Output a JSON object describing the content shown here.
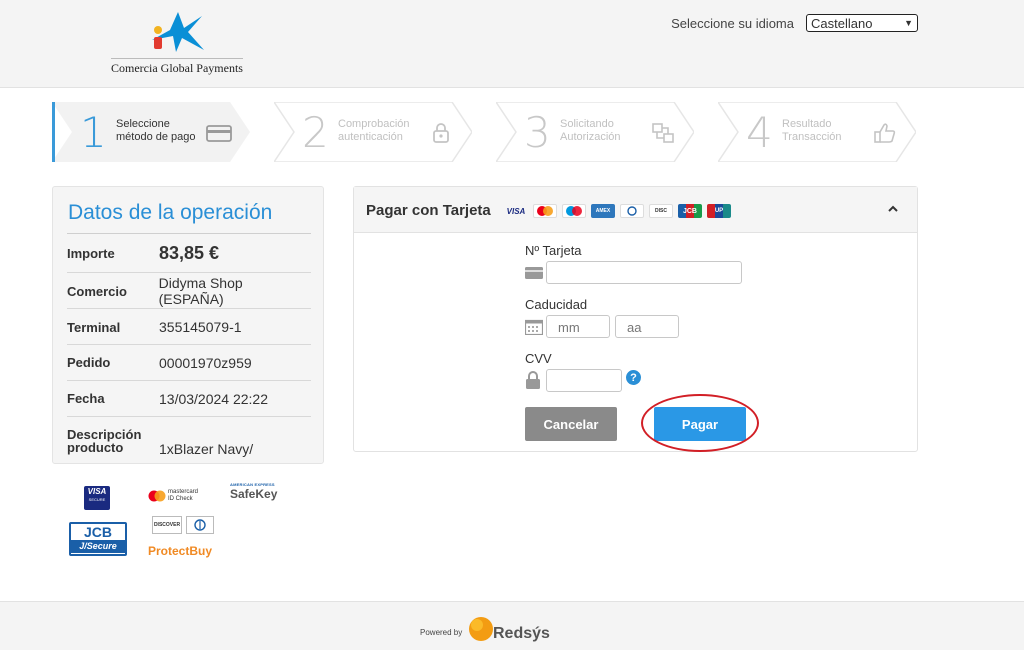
{
  "header": {
    "logo_text": "Comercia Global Payments",
    "language_label": "Seleccione su idioma",
    "language_selected": "Castellano"
  },
  "steps": [
    {
      "number": "1",
      "line1": "Seleccione",
      "line2": "método de pago",
      "icon": "credit-card-icon",
      "active": true
    },
    {
      "number": "2",
      "line1": "Comprobación",
      "line2": "autenticación",
      "icon": "lock-icon",
      "active": false
    },
    {
      "number": "3",
      "line1": "Solicitando",
      "line2": "Autorización",
      "icon": "transfer-icon",
      "active": false
    },
    {
      "number": "4",
      "line1": "Resultado",
      "line2": "Transacción",
      "icon": "thumbs-up-icon",
      "active": false
    }
  ],
  "operation": {
    "title": "Datos de la operación",
    "rows": [
      {
        "key": "Importe",
        "value": "83,85 €"
      },
      {
        "key": "Comercio",
        "value": "Didyma Shop (ESPAÑA)"
      },
      {
        "key": "Terminal",
        "value": "355145079-1"
      },
      {
        "key": "Pedido",
        "value": "00001970z959"
      },
      {
        "key": "Fecha",
        "value": "13/03/2024  22:22"
      },
      {
        "key": "Descripción producto",
        "value": "1xBlazer Navy/"
      }
    ]
  },
  "brands": {
    "visa": "VISA",
    "visa_sub": "SECURE",
    "mastercard": "mastercard",
    "mastercard_sub": "ID Check",
    "amex_top": "AMERICAN EXPRESS",
    "safekey": "SafeKey",
    "jcb": "JCB",
    "jcb_sub": "J/Secure",
    "discover": "DISCOVER",
    "protectbuy": "ProtectBuy"
  },
  "card_panel": {
    "title": "Pagar con Tarjeta",
    "card_logos": [
      "VISA",
      "MC",
      "MA",
      "AMEX",
      "DC",
      "DISC",
      "JCB",
      "UP"
    ],
    "card_number_label": "Nº Tarjeta",
    "card_number_value": "",
    "expiry_label": "Caducidad",
    "month_placeholder": "mm",
    "year_placeholder": "aa",
    "cvv_label": "CVV",
    "cvv_value": "",
    "help_glyph": "?",
    "cancel_label": "Cancelar",
    "pay_label": "Pagar"
  },
  "footer": {
    "powered_by": "Powered by",
    "brand": "Redsýs"
  },
  "colors": {
    "accent": "#2a8fd6",
    "pay_button": "#2a98e6",
    "cancel_button": "#8a8a8a",
    "highlight_ring": "#d21f26"
  }
}
